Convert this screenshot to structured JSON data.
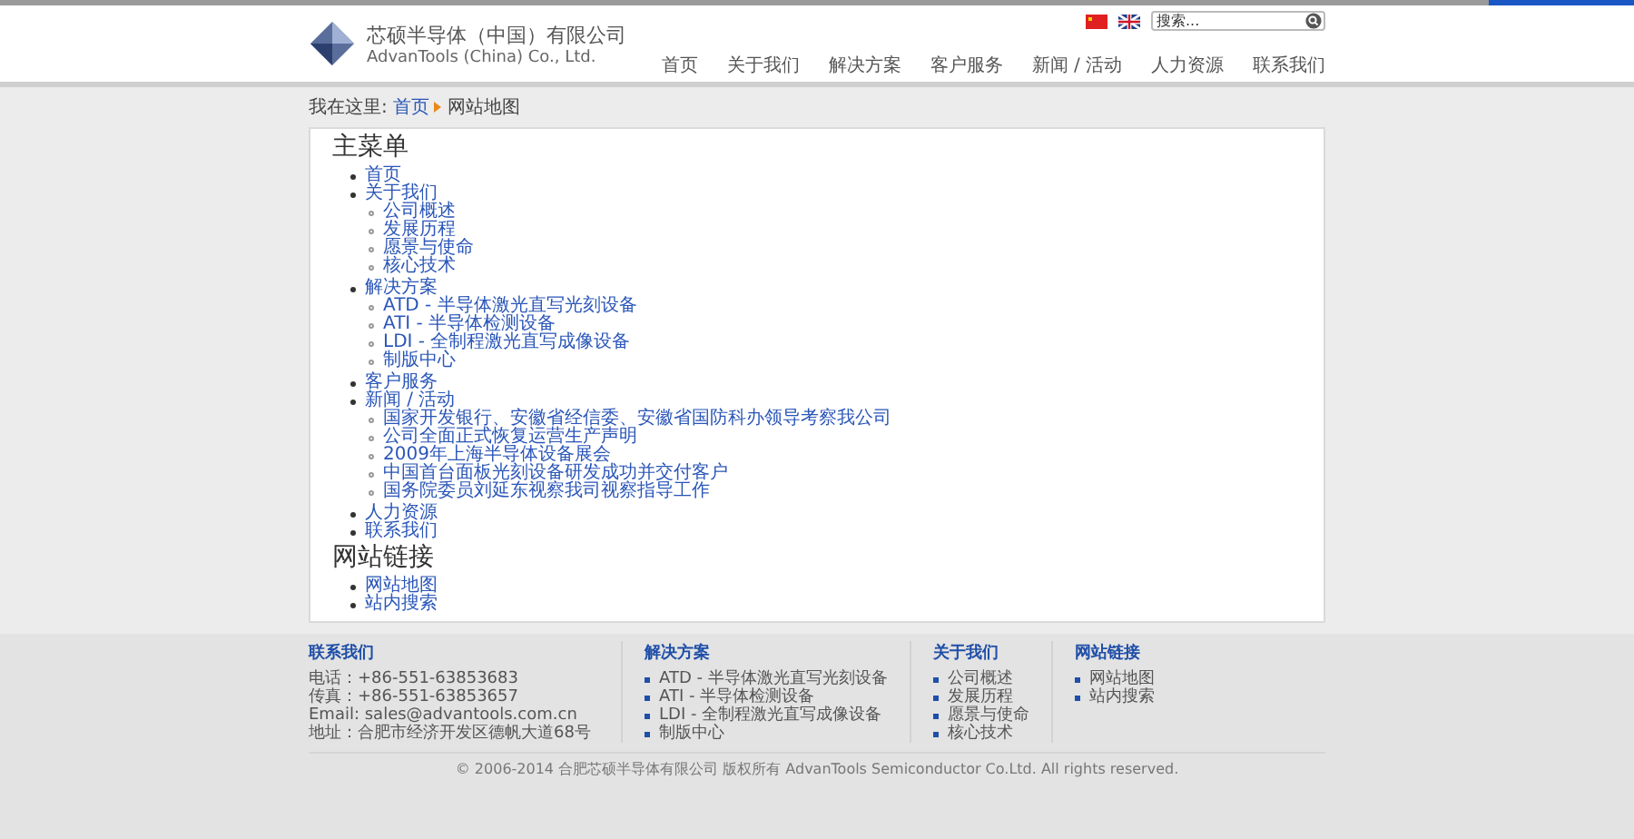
{
  "header": {
    "company_cn": "芯硕半导体（中国）有限公司",
    "company_en": "AdvanTools (China) Co., Ltd.",
    "search": {
      "placeholder": "搜索..."
    },
    "nav": [
      {
        "label": "首页"
      },
      {
        "label": "关于我们"
      },
      {
        "label": "解决方案"
      },
      {
        "label": "客户服务"
      },
      {
        "label": "新闻 / 活动"
      },
      {
        "label": "人力资源"
      },
      {
        "label": "联系我们"
      }
    ]
  },
  "breadcrumb": {
    "prefix": "我在这里:",
    "link": "首页",
    "current": "网站地图"
  },
  "sections": [
    {
      "title": "主菜单",
      "items": [
        {
          "label": "首页"
        },
        {
          "label": "关于我们",
          "children": [
            {
              "label": "公司概述"
            },
            {
              "label": "发展历程"
            },
            {
              "label": "愿景与使命"
            },
            {
              "label": "核心技术"
            }
          ]
        },
        {
          "label": "解决方案",
          "children": [
            {
              "label": "ATD - 半导体激光直写光刻设备"
            },
            {
              "label": "ATI - 半导体检测设备"
            },
            {
              "label": "LDI - 全制程激光直写成像设备"
            },
            {
              "label": "制版中心"
            }
          ]
        },
        {
          "label": "客户服务"
        },
        {
          "label": "新闻 / 活动",
          "children": [
            {
              "label": "国家开发银行、安徽省经信委、安徽省国防科办领导考察我公司"
            },
            {
              "label": "公司全面正式恢复运营生产声明"
            },
            {
              "label": "2009年上海半导体设备展会"
            },
            {
              "label": "中国首台面板光刻设备研发成功并交付客户"
            },
            {
              "label": "国务院委员刘延东视察我司视察指导工作"
            }
          ]
        },
        {
          "label": "人力资源"
        },
        {
          "label": "联系我们"
        }
      ]
    },
    {
      "title": "网站链接",
      "items": [
        {
          "label": "网站地图"
        },
        {
          "label": "站内搜索"
        }
      ]
    }
  ],
  "footer": {
    "contact": {
      "title": "联系我们",
      "lines": [
        "电话：+86-551-63853683",
        "传真：+86-551-63853657",
        "Email: sales@advantools.com.cn",
        "地址：合肥市经济开发区德帆大道68号"
      ]
    },
    "columns": [
      {
        "title": "解决方案",
        "items": [
          "ATD - 半导体激光直写光刻设备",
          "ATI - 半导体检测设备",
          "LDI - 全制程激光直写成像设备",
          "制版中心"
        ]
      },
      {
        "title": "关于我们",
        "items": [
          "公司概述",
          "发展历程",
          "愿景与使命",
          "核心技术"
        ]
      },
      {
        "title": "网站链接",
        "items": [
          "网站地图",
          "站内搜索"
        ]
      }
    ],
    "copyright": "© 2006-2014 合肥芯硕半导体有限公司 版权所有 AdvanTools Semiconductor Co.Ltd. All rights reserved."
  }
}
